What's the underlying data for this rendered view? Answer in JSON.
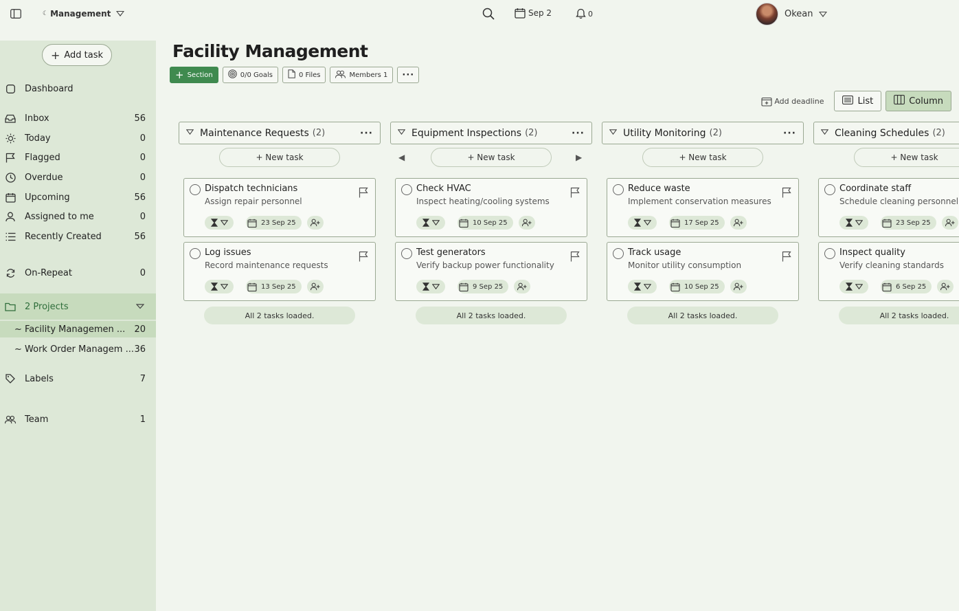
{
  "topbar": {
    "workspace": "Management",
    "date": "Sep 2",
    "notifications": "0",
    "user": "Okean"
  },
  "sidebar": {
    "add_task": "Add task",
    "items": [
      {
        "label": "Dashboard",
        "count": ""
      },
      {
        "label": "Inbox",
        "count": "56"
      },
      {
        "label": "Today",
        "count": "0"
      },
      {
        "label": "Flagged",
        "count": "0"
      },
      {
        "label": "Overdue",
        "count": "0"
      },
      {
        "label": "Upcoming",
        "count": "56"
      },
      {
        "label": "Assigned to me",
        "count": "0"
      },
      {
        "label": "Recently Created",
        "count": "56"
      },
      {
        "label": "On-Repeat",
        "count": "0"
      },
      {
        "label": "2 Projects",
        "count": ""
      },
      {
        "label": "~ Facility Managemen ...",
        "count": "20"
      },
      {
        "label": "~ Work Order Managem ...",
        "count": "36"
      },
      {
        "label": "Labels",
        "count": "7"
      },
      {
        "label": "Team",
        "count": "1"
      }
    ]
  },
  "main": {
    "title": "Facility Management",
    "tools": {
      "section": "Section",
      "goals": "0/0 Goals",
      "files": "0 Files",
      "members": "Members 1"
    },
    "view": {
      "add_deadline": "Add deadline",
      "list": "List",
      "column": "Column"
    },
    "new_task": "+ New task",
    "loaded": "All 2 tasks loaded.",
    "columns": [
      {
        "name": "Maintenance Requests",
        "count": "(2)",
        "tasks": [
          {
            "title": "Dispatch technicians",
            "desc": "Assign repair personnel",
            "date": "23 Sep 25"
          },
          {
            "title": "Log issues",
            "desc": "Record maintenance requests",
            "date": "13 Sep 25"
          }
        ]
      },
      {
        "name": "Equipment Inspections",
        "count": "(2)",
        "tasks": [
          {
            "title": "Check HVAC",
            "desc": "Inspect heating/cooling systems",
            "date": "10 Sep 25"
          },
          {
            "title": "Test generators",
            "desc": "Verify backup power functionality",
            "date": "9 Sep 25"
          }
        ]
      },
      {
        "name": "Utility Monitoring",
        "count": "(2)",
        "tasks": [
          {
            "title": "Reduce waste",
            "desc": "Implement conservation measures",
            "date": "17 Sep 25"
          },
          {
            "title": "Track usage",
            "desc": "Monitor utility consumption",
            "date": "10 Sep 25"
          }
        ]
      },
      {
        "name": "Cleaning Schedules",
        "count": "(2)",
        "tasks": [
          {
            "title": "Coordinate staff",
            "desc": "Schedule cleaning personnel",
            "date": "23 Sep 25"
          },
          {
            "title": "Inspect quality",
            "desc": "Verify cleaning standards",
            "date": "6 Sep 25"
          }
        ]
      }
    ]
  }
}
